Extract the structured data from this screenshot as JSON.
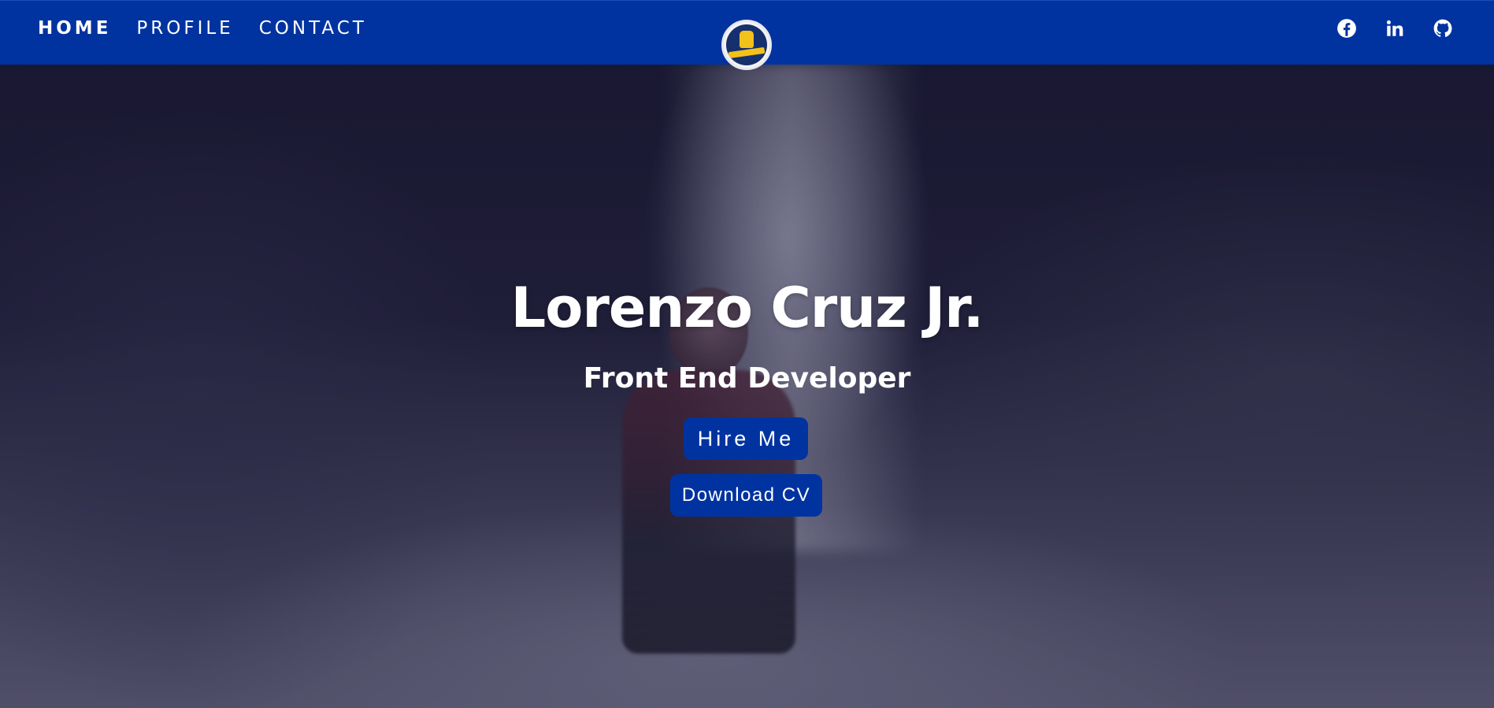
{
  "nav": {
    "links": [
      {
        "label": "HOME",
        "active": true
      },
      {
        "label": "PROFILE",
        "active": false
      },
      {
        "label": "CONTACT",
        "active": false
      }
    ],
    "logo_icon": "revolutionary-fist-logo",
    "social": [
      "facebook-icon",
      "linkedin-icon",
      "github-icon"
    ],
    "bar_color": "#0033a0"
  },
  "hero": {
    "name": "Lorenzo Cruz Jr.",
    "role": "Front End Developer",
    "hire_button": "Hire Me",
    "cv_button": "Download CV",
    "background": "waterfall photo with dark purple overlay"
  },
  "colors": {
    "accent": "#0033a0",
    "text": "#ffffff"
  }
}
